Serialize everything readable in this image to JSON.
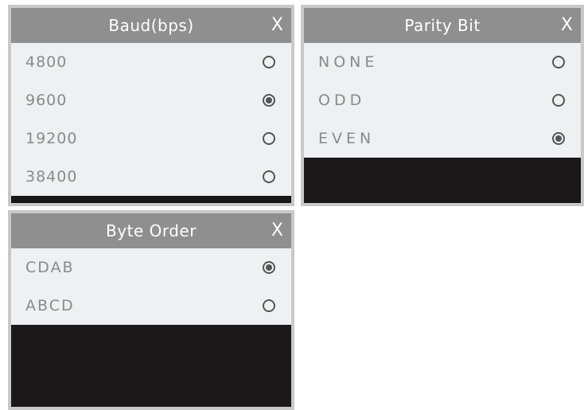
{
  "baud": {
    "title": "Baud(bps)",
    "close": "X",
    "options": [
      {
        "label": "4800",
        "selected": false
      },
      {
        "label": "9600",
        "selected": true
      },
      {
        "label": "19200",
        "selected": false
      },
      {
        "label": "38400",
        "selected": false
      }
    ]
  },
  "parity": {
    "title": "Parity Bit",
    "close": "X",
    "options": [
      {
        "label": "NONE",
        "selected": false
      },
      {
        "label": "ODD",
        "selected": false
      },
      {
        "label": "EVEN",
        "selected": true
      }
    ]
  },
  "byte_order": {
    "title": "Byte Order",
    "close": "X",
    "options": [
      {
        "label": "CDAB",
        "selected": true
      },
      {
        "label": "ABCD",
        "selected": false
      }
    ]
  },
  "colors": {
    "titlebar": "#8f8f90",
    "options_bg": "#eff0f2",
    "empty_area": "#1a1818",
    "panel_border": "#c9c9c9",
    "option_text": "#8a8a8a",
    "radio": "#555555"
  }
}
